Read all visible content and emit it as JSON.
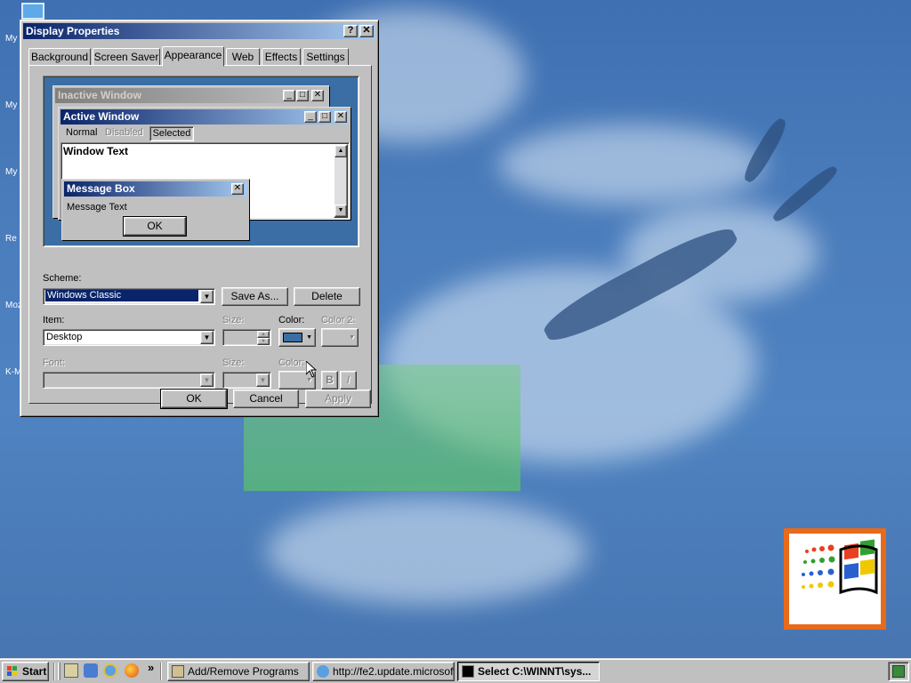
{
  "desktop": {
    "icon_labels": [
      "My",
      "My D",
      "My",
      "Re",
      "Moz",
      "K-M"
    ]
  },
  "window": {
    "title": "Display Properties",
    "help_glyph": "?",
    "close_glyph": "✕",
    "tabs": [
      "Background",
      "Screen Saver",
      "Appearance",
      "Web",
      "Effects",
      "Settings"
    ],
    "active_tab": "Appearance"
  },
  "preview": {
    "inactive_title": "Inactive Window",
    "active_title": "Active Window",
    "menu": [
      "Normal",
      "Disabled",
      "Selected"
    ],
    "window_text": "Window Text",
    "msgbox_title": "Message Box",
    "msgbox_text": "Message Text",
    "msgbox_ok": "OK"
  },
  "appearance": {
    "scheme_label": "Scheme:",
    "scheme_value": "Windows Classic",
    "save_as": "Save As...",
    "delete": "Delete",
    "item_label": "Item:",
    "item_value": "Desktop",
    "size_label": "Size:",
    "color_label": "Color:",
    "color2_label": "Color 2:",
    "font_label": "Font:",
    "font_size_label": "Size:",
    "font_color_label": "Color:",
    "bold_glyph": "B",
    "italic_glyph": "I",
    "desktop_color": "#3a6ea5"
  },
  "dialog_buttons": {
    "ok": "OK",
    "cancel": "Cancel",
    "apply": "Apply"
  },
  "taskbar": {
    "start": "Start",
    "tasks": [
      "Add/Remove Programs",
      "http://fe2.update.microsoft...",
      "Select C:\\WINNT\\sys..."
    ],
    "chevron": "»"
  },
  "colors": {
    "title_active_start": "#0a246a",
    "title_active_end": "#a6caf0",
    "title_inactive_start": "#808080",
    "title_inactive_end": "#c0c0c0",
    "selection": "#0a246a",
    "face": "#c0c0c0"
  }
}
